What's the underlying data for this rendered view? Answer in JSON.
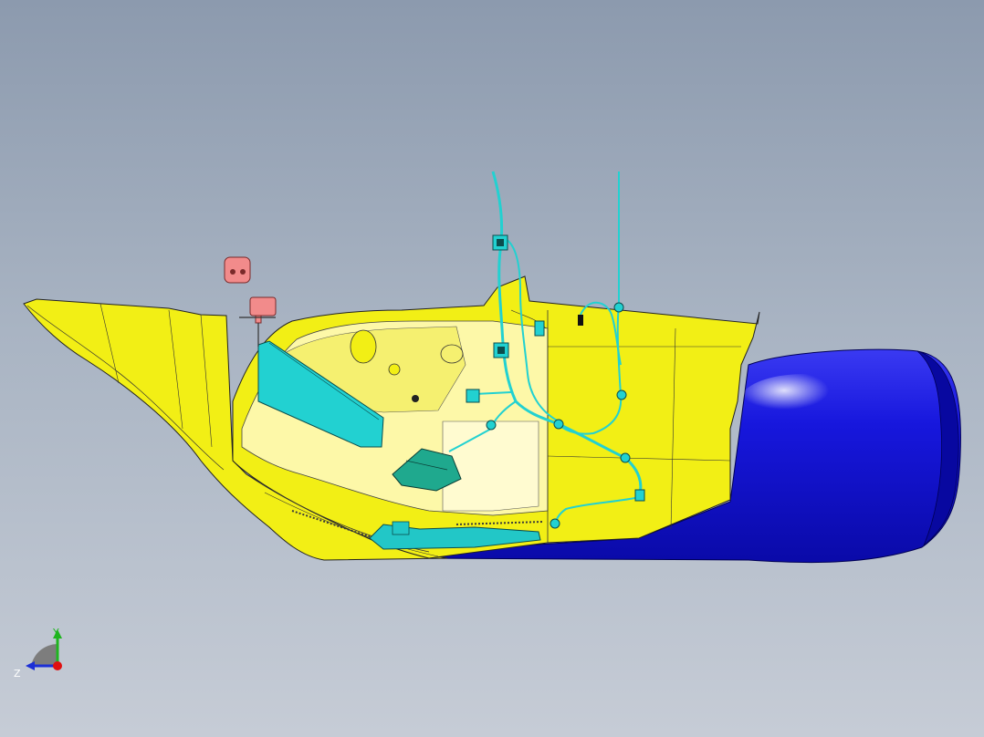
{
  "scene": {
    "parts": [
      {
        "name": "side-panel",
        "color": "#f2ef15"
      },
      {
        "name": "inner-cavity",
        "color": "#fdf8a8"
      },
      {
        "name": "wiring-harness",
        "color": "#22d1d1"
      },
      {
        "name": "clip-brackets",
        "color": "#f28b8b"
      },
      {
        "name": "bumper-fascia",
        "color": "#1010e0"
      }
    ]
  },
  "triad": {
    "y_label": "Y",
    "z_label": "Z",
    "colors": {
      "y": "#1fb51f",
      "z": "#1c2fd6",
      "x": "#e01010"
    }
  }
}
